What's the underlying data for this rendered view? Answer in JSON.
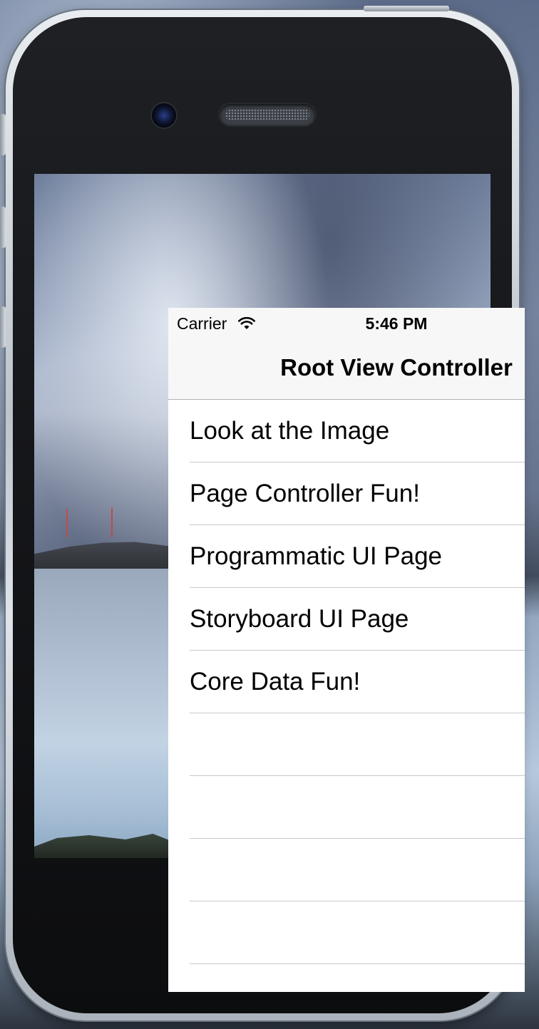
{
  "status_bar": {
    "carrier": "Carrier",
    "time": "5:46 PM",
    "wifi_icon": "wifi-icon"
  },
  "navigation_bar": {
    "title": "Root View Controller"
  },
  "table": {
    "rows": [
      {
        "label": "Look at the Image"
      },
      {
        "label": "Page Controller Fun!"
      },
      {
        "label": "Programmatic UI Page"
      },
      {
        "label": "Storyboard UI Page"
      },
      {
        "label": "Core Data Fun!"
      },
      {
        "label": ""
      },
      {
        "label": ""
      },
      {
        "label": ""
      },
      {
        "label": ""
      }
    ]
  },
  "colors": {
    "navbar_background": "#f7f7f7",
    "separator": "#c8c7cc",
    "cell_background": "#ffffff"
  }
}
